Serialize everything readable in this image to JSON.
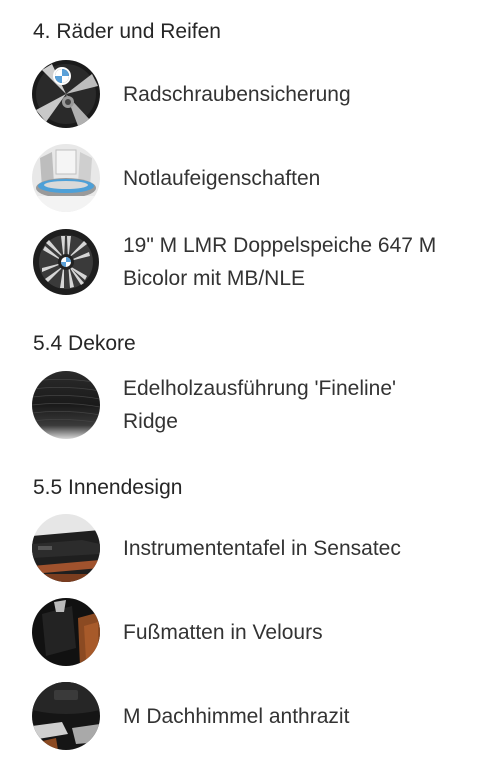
{
  "sections": [
    {
      "title": "4. Räder und Reifen",
      "items": [
        {
          "icon": "wheel-lock-icon",
          "label_lines": [
            "Radschraubensicherung"
          ]
        },
        {
          "icon": "runflat-tire-icon",
          "label_lines": [
            "Notlaufeigenschaften"
          ]
        },
        {
          "icon": "alloy-wheel-icon",
          "label_lines": [
            "19\" M LMR Doppelspeiche 647 M",
            "Bicolor mit MB/NLE"
          ]
        }
      ]
    },
    {
      "title": "5.4 Dekore",
      "items": [
        {
          "icon": "wood-trim-icon",
          "label_lines": [
            "Edelholzausführung 'Fineline'",
            "Ridge"
          ]
        }
      ]
    },
    {
      "title": "5.5 Innendesign",
      "items": [
        {
          "icon": "dashboard-icon",
          "label_lines": [
            "Instrumententafel in Sensatec"
          ]
        },
        {
          "icon": "floor-mat-icon",
          "label_lines": [
            "Fußmatten in Velours"
          ]
        },
        {
          "icon": "headliner-icon",
          "label_lines": [
            "M Dachhimmel anthrazit"
          ]
        }
      ]
    }
  ]
}
